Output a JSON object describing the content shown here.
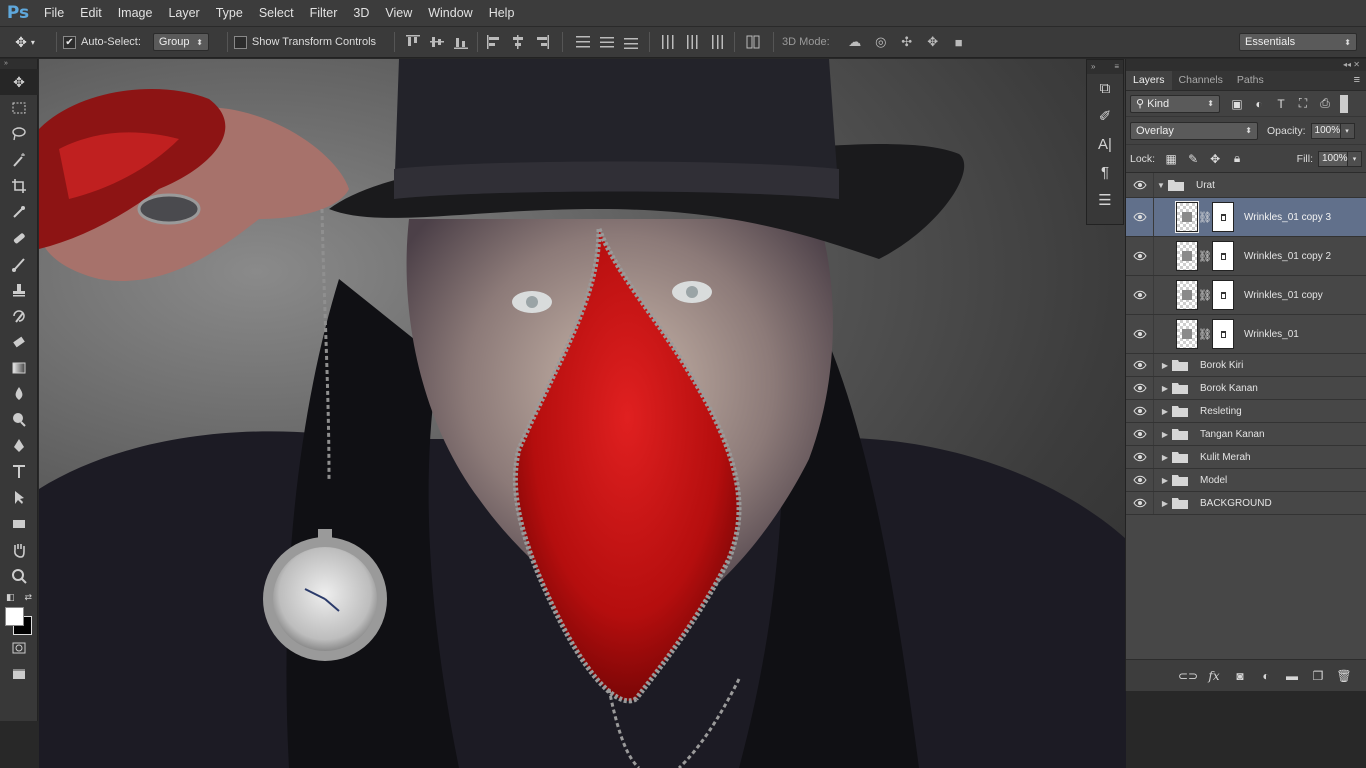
{
  "app": {
    "logo": "Ps"
  },
  "menu": [
    "File",
    "Edit",
    "Image",
    "Layer",
    "Type",
    "Select",
    "Filter",
    "3D",
    "View",
    "Window",
    "Help"
  ],
  "options": {
    "auto_select_label": "Auto-Select:",
    "auto_select_checked": true,
    "auto_select_value": "Group",
    "transform_controls_label": "Show Transform Controls",
    "transform_controls_checked": false,
    "mode_label": "3D Mode:",
    "workspace": "Essentials"
  },
  "layers_panel": {
    "tabs": [
      "Layers",
      "Channels",
      "Paths"
    ],
    "active_tab": "Layers",
    "filter_kind": "Kind",
    "blend_mode": "Overlay",
    "opacity_label": "Opacity:",
    "opacity": "100%",
    "lock_label": "Lock:",
    "fill_label": "Fill:",
    "fill": "100%",
    "group_open": {
      "name": "Urat"
    },
    "child_layers": [
      {
        "name": "Wrinkles_01 copy 3",
        "selected": true
      },
      {
        "name": "Wrinkles_01 copy 2",
        "selected": false
      },
      {
        "name": "Wrinkles_01 copy",
        "selected": false
      },
      {
        "name": "Wrinkles_01",
        "selected": false
      }
    ],
    "groups": [
      "Borok Kiri",
      "Borok Kanan",
      "Resleting",
      "Tangan Kanan",
      "Kulit Merah",
      "Model",
      "BACKGROUND"
    ]
  },
  "colors": {
    "selection": "#61708b",
    "face_red": "#d11414",
    "ps_blue": "#5fa8dc"
  }
}
